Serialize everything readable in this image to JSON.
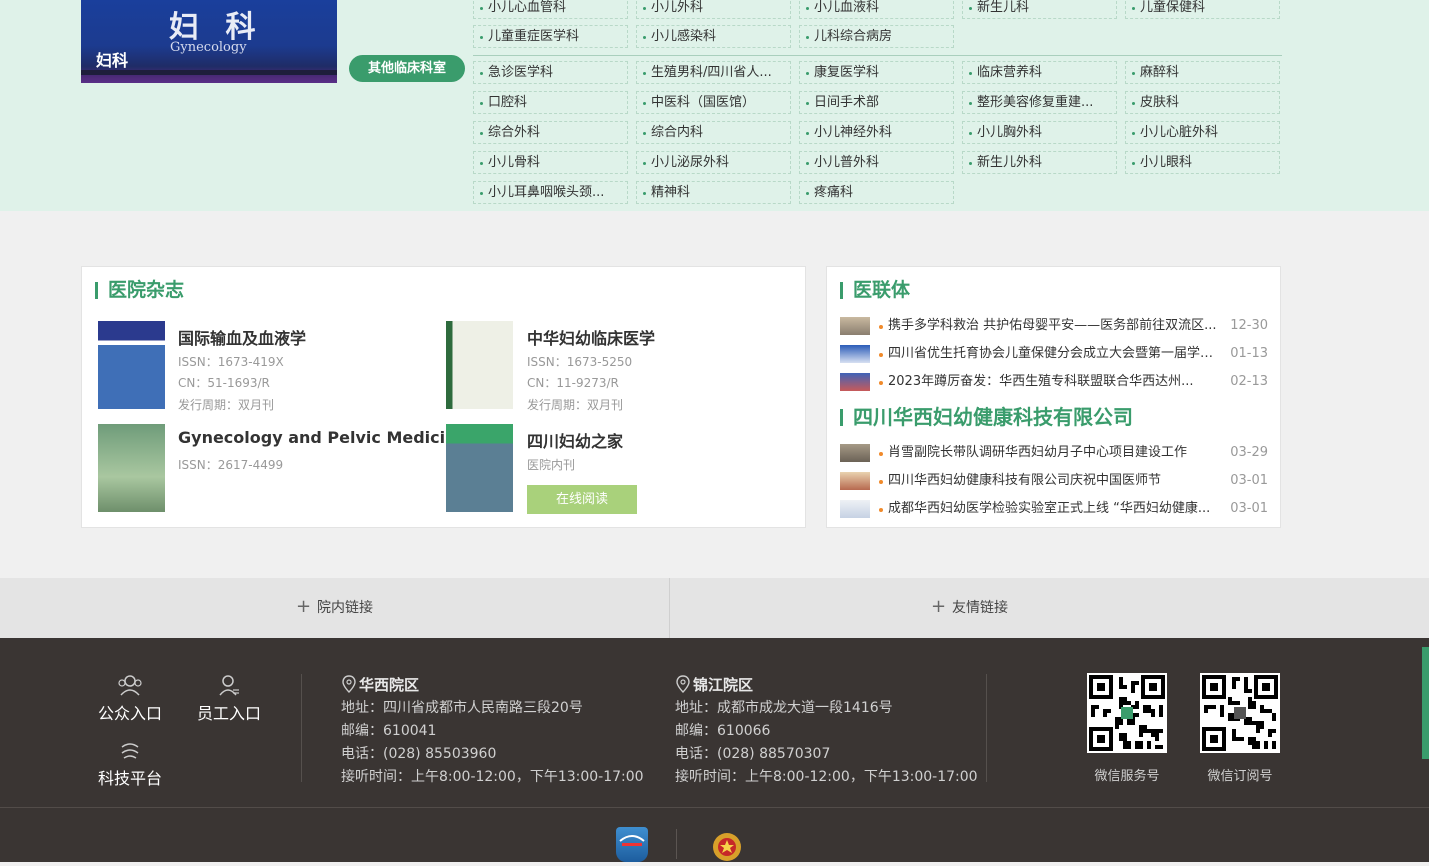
{
  "banner": {
    "title_big": "妇 科",
    "title_en": "Gynecology",
    "label": "妇科"
  },
  "other_tag": "其他临床科室",
  "depts_top": [
    [
      "小儿心血管科",
      "小儿外科",
      "小儿血液科",
      "新生儿科",
      "儿童保健科"
    ],
    [
      "儿童重症医学科",
      "小儿感染科",
      "儿科综合病房"
    ]
  ],
  "depts_other": [
    [
      "急诊医学科",
      "生殖男科/四川省人...",
      "康复医学科",
      "临床营养科",
      "麻醉科"
    ],
    [
      "口腔科",
      "中医科（国医馆）",
      "日间手术部",
      "整形美容修复重建...",
      "皮肤科"
    ],
    [
      "综合外科",
      "综合内科",
      "小儿神经外科",
      "小儿胸外科",
      "小儿心脏外科"
    ],
    [
      "小儿骨科",
      "小儿泌尿外科",
      "小儿普外科",
      "新生儿外科",
      "小儿眼科"
    ],
    [
      "小儿耳鼻咽喉头颈...",
      "精神科",
      "疼痛科"
    ]
  ],
  "magazines": {
    "title": "医院杂志",
    "items": [
      {
        "name": "国际输血及血液学",
        "issn": "ISSN：1673-419X",
        "cn": "CN：51-1693/R",
        "period": "发行周期：双月刊"
      },
      {
        "name": "中华妇幼临床医学",
        "issn": "ISSN：1673-5250",
        "cn": "CN：11-9273/R",
        "period": "发行周期：双月刊"
      },
      {
        "name": "Gynecology and Pelvic Medicine",
        "issn": "ISSN：2617-4499"
      },
      {
        "name": "四川妇幼之家",
        "note": "医院内刊",
        "button": "在线阅读"
      }
    ]
  },
  "alliance": {
    "title": "医联体",
    "news": [
      {
        "text": "携手多学科救治 共护佑母婴平安——医务部前往双流区...",
        "date": "12-30"
      },
      {
        "text": "四川省优生托育协会儿童保健分会成立大会暨第一届学术...",
        "date": "01-13"
      },
      {
        "text": "2023年蹲厉奋发：华西生殖专科联盟联合华西达州...",
        "date": "02-13"
      }
    ]
  },
  "company": {
    "title": "四川华西妇幼健康科技有限公司",
    "news": [
      {
        "text": "肖雪副院长带队调研华西妇幼月子中心项目建设工作",
        "date": "03-29"
      },
      {
        "text": "四川华西妇幼健康科技有限公司庆祝中国医师节",
        "date": "03-01"
      },
      {
        "text": "成都华西妇幼医学检验实验室正式上线 “华西妇幼健康...",
        "date": "03-01"
      }
    ]
  },
  "links": {
    "internal": "院内链接",
    "friendly": "友情链接"
  },
  "footer": {
    "entries": {
      "public": "公众入口",
      "staff": "员工入口",
      "tech": "科技平台"
    },
    "campus1": {
      "name": "华西院区",
      "address": "地址：四川省成都市人民南路三段20号",
      "zip": "邮编：610041",
      "phone": "电话：(028) 85503960",
      "hours": "接听时间：上午8:00-12:00，下午13:00-17:00"
    },
    "campus2": {
      "name": "锦江院区",
      "address": "地址：成都市成龙大道一段1416号",
      "zip": "邮编：610066",
      "phone": "电话：(028) 88570307",
      "hours": "接听时间：上午8:00-12:00，下午13:00-17:00"
    },
    "qr1": "微信服务号",
    "qr2": "微信订阅号"
  }
}
